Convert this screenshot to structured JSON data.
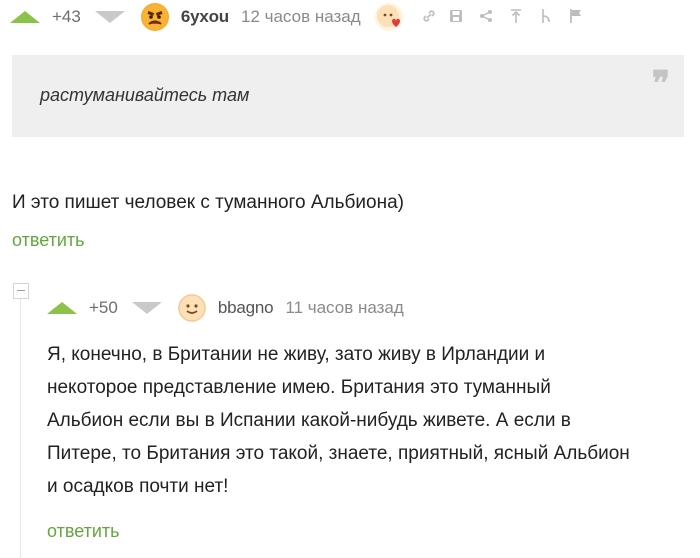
{
  "comment1": {
    "rating": "+43",
    "username": "6yxou",
    "time": "12 часов назад",
    "quote": "растуманивайтесь там",
    "quote_mark": "❞",
    "text": "И это пишет человек с туманного Альбиона)",
    "reply": "ответить",
    "tools": [
      "link-icon",
      "save-icon",
      "share-icon",
      "pin-icon",
      "branch-icon",
      "flag-icon"
    ]
  },
  "comment2": {
    "rating": "+50",
    "username": "bbagno",
    "time": "11 часов назад",
    "text_lines": [
      "Я, конечно, в Британии не живу, зато живу в Ирландии и",
      "некоторое представление имею. Британия это туманный",
      "Альбион если вы в Испании какой-нибудь живете. А если в",
      "Питере, то Британия это такой, знаете, приятный, ясный Альбион",
      "и осадков почти нет!"
    ],
    "reply": "ответить"
  },
  "colors": {
    "accent": "#8bc34a",
    "link": "#64a63e",
    "quote_bg": "#efefef"
  }
}
